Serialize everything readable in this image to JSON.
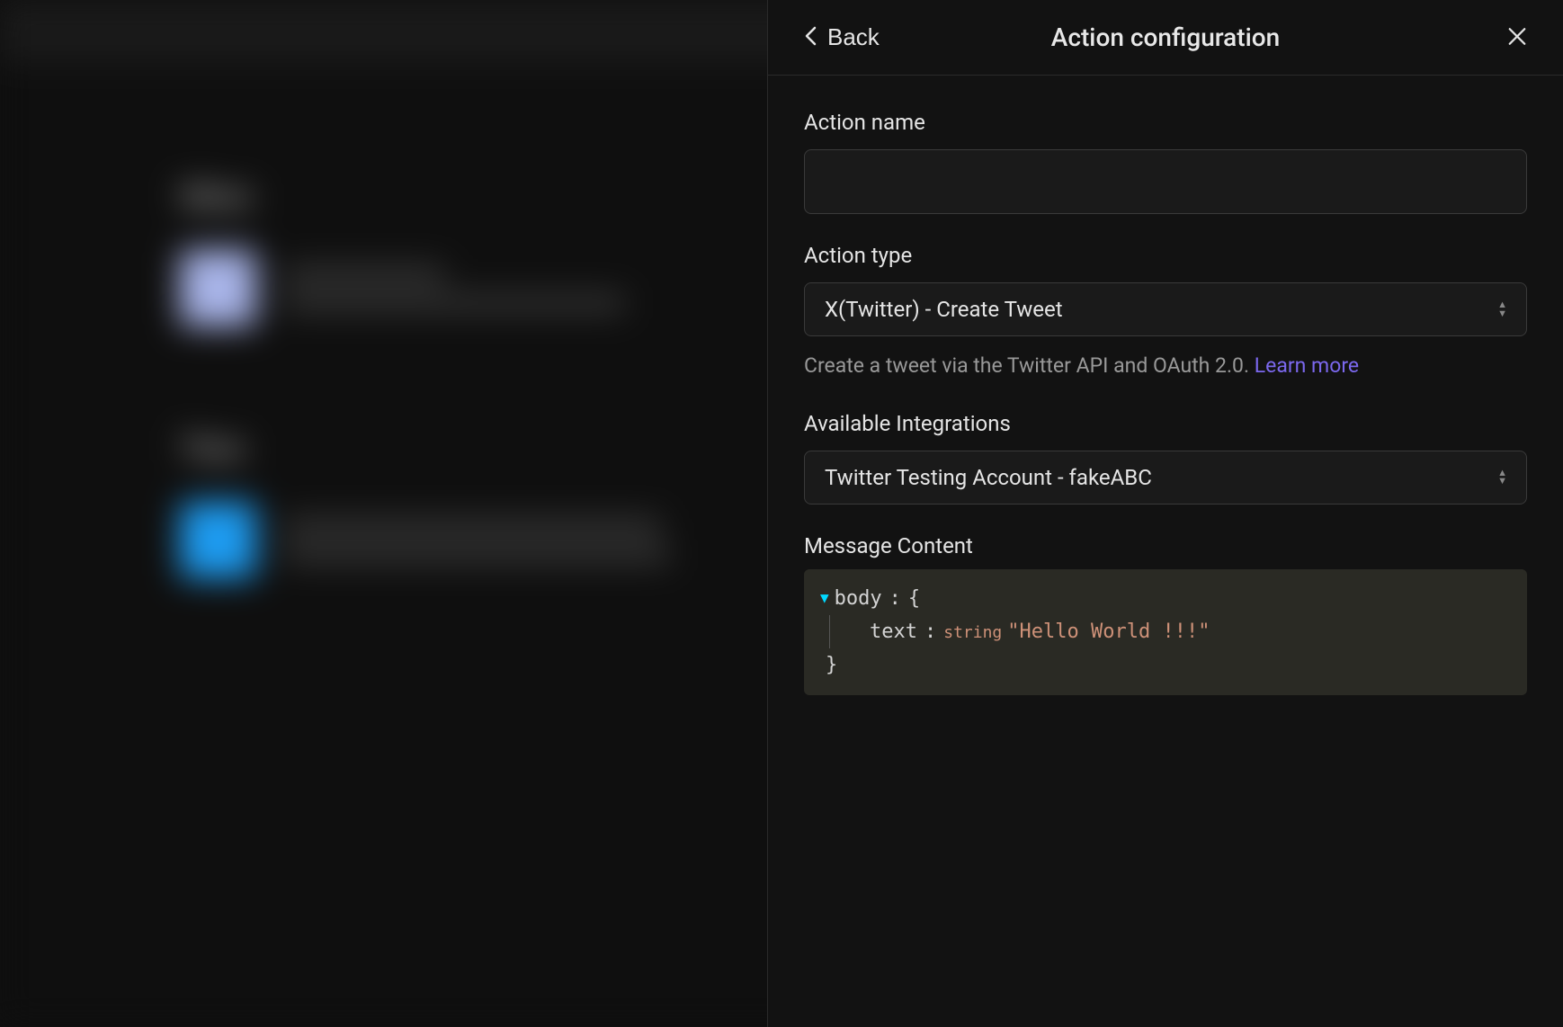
{
  "panel": {
    "back_label": "Back",
    "title": "Action configuration"
  },
  "fields": {
    "action_name": {
      "label": "Action name",
      "value": ""
    },
    "action_type": {
      "label": "Action type",
      "selected": "X(Twitter) - Create Tweet",
      "description": "Create a tweet via the Twitter API and OAuth 2.0. ",
      "learn_more": "Learn more"
    },
    "integrations": {
      "label": "Available Integrations",
      "selected": "Twitter Testing Account - fakeABC"
    },
    "message_content": {
      "label": "Message Content",
      "code": {
        "root_key": "body",
        "open_brace": "{",
        "close_brace": "}",
        "child_key": "text",
        "child_type": "string",
        "child_value": "\"Hello World !!!\""
      }
    }
  },
  "background": {
    "heading1": "When",
    "heading2": "Then"
  }
}
